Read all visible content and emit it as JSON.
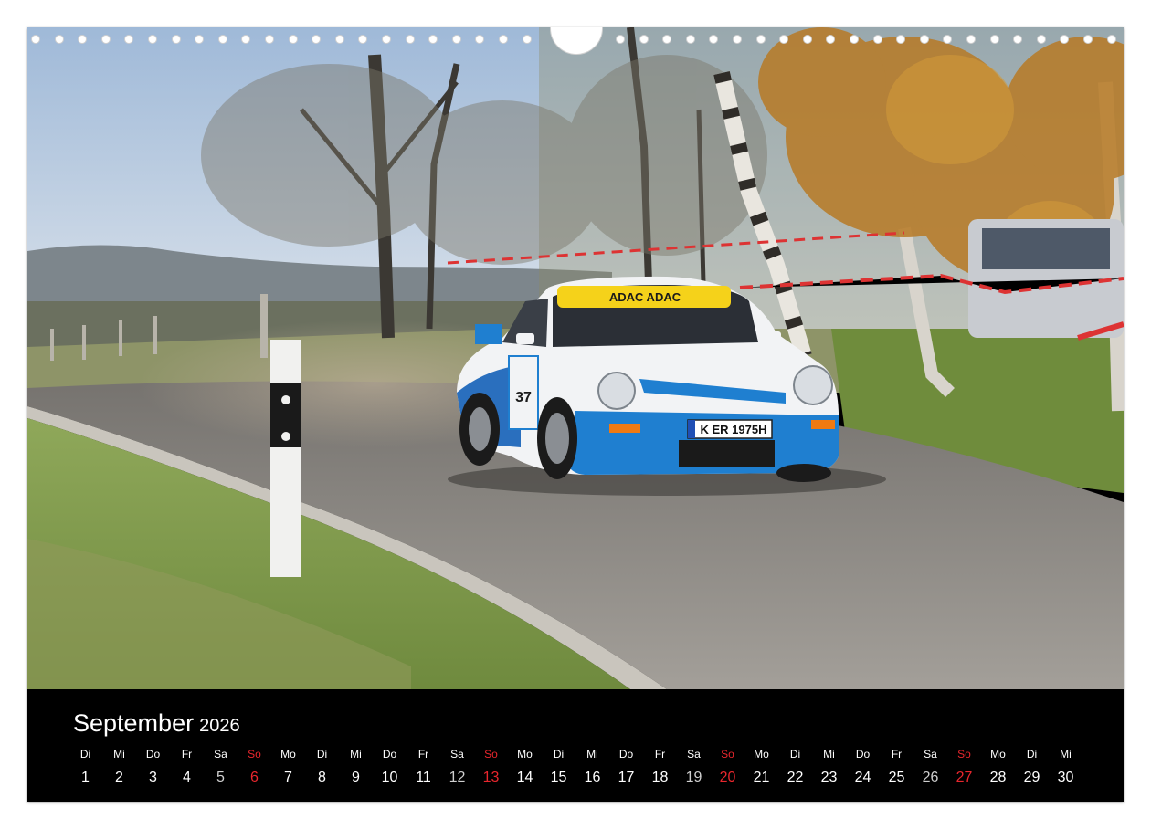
{
  "calendar": {
    "month": "September",
    "year": "2026",
    "days": [
      {
        "dow": "Di",
        "num": "1"
      },
      {
        "dow": "Mi",
        "num": "2"
      },
      {
        "dow": "Do",
        "num": "3"
      },
      {
        "dow": "Fr",
        "num": "4"
      },
      {
        "dow": "Sa",
        "num": "5"
      },
      {
        "dow": "So",
        "num": "6"
      },
      {
        "dow": "Mo",
        "num": "7"
      },
      {
        "dow": "Di",
        "num": "8"
      },
      {
        "dow": "Mi",
        "num": "9"
      },
      {
        "dow": "Do",
        "num": "10"
      },
      {
        "dow": "Fr",
        "num": "11"
      },
      {
        "dow": "Sa",
        "num": "12"
      },
      {
        "dow": "So",
        "num": "13"
      },
      {
        "dow": "Mo",
        "num": "14"
      },
      {
        "dow": "Di",
        "num": "15"
      },
      {
        "dow": "Mi",
        "num": "16"
      },
      {
        "dow": "Do",
        "num": "17"
      },
      {
        "dow": "Fr",
        "num": "18"
      },
      {
        "dow": "Sa",
        "num": "19"
      },
      {
        "dow": "So",
        "num": "20"
      },
      {
        "dow": "Mo",
        "num": "21"
      },
      {
        "dow": "Di",
        "num": "22"
      },
      {
        "dow": "Mi",
        "num": "23"
      },
      {
        "dow": "Do",
        "num": "24"
      },
      {
        "dow": "Fr",
        "num": "25"
      },
      {
        "dow": "Sa",
        "num": "26"
      },
      {
        "dow": "So",
        "num": "27"
      },
      {
        "dow": "Mo",
        "num": "28"
      },
      {
        "dow": "Di",
        "num": "29"
      },
      {
        "dow": "Mi",
        "num": "30"
      }
    ]
  },
  "photo": {
    "windshield_banner": "ADAC ADAC",
    "license_plate": "K ER 1975H",
    "door_number": "37",
    "colors": {
      "sky": "#b9cde3",
      "road": "#8f8c88",
      "grass": "#7d9a4c",
      "car_white": "#f2f3f5",
      "car_blue": "#1f7fd0",
      "banner_yellow": "#f5d21a",
      "sunday_red": "#e8262d"
    }
  }
}
